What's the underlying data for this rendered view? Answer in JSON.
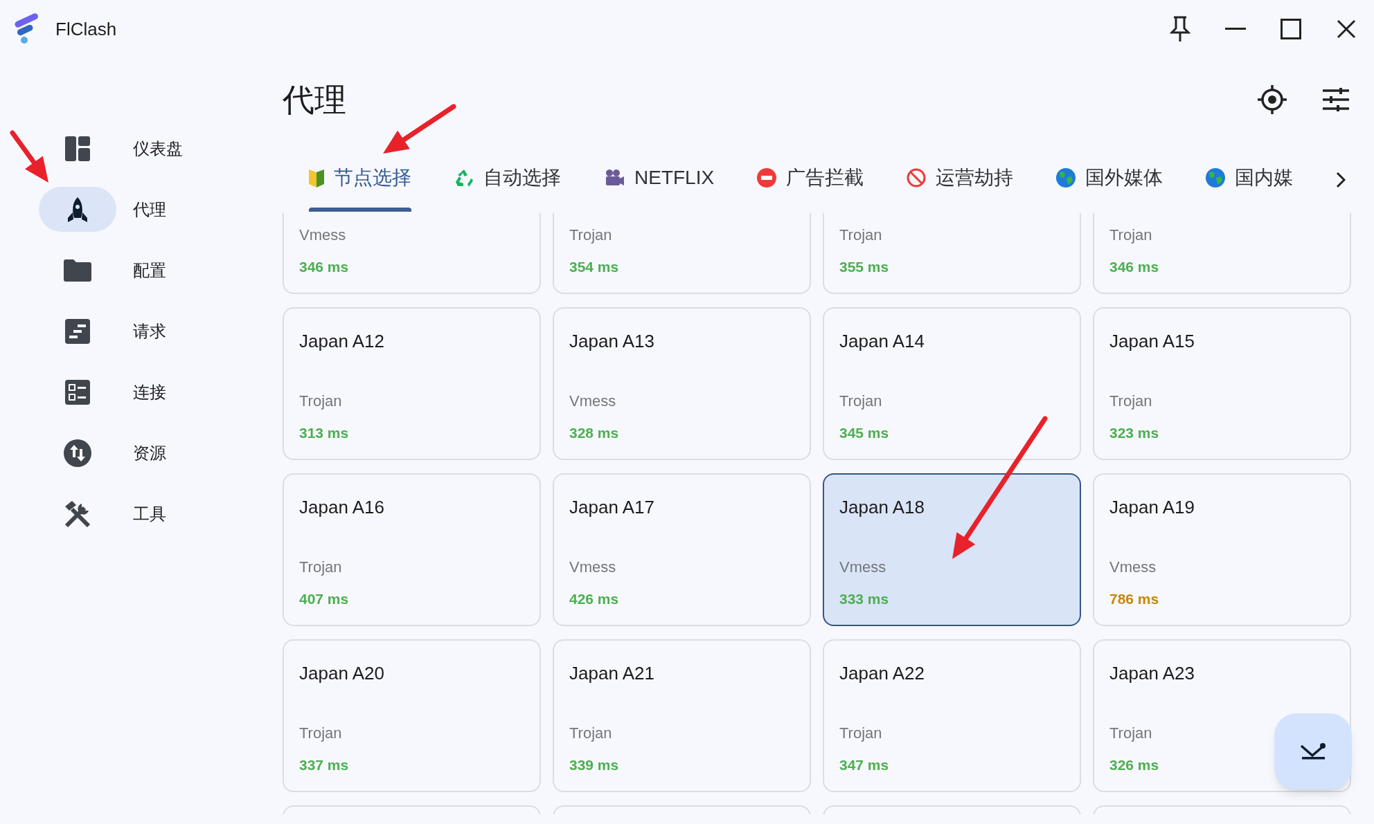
{
  "app": {
    "title": "FlClash"
  },
  "sidebar": {
    "items": [
      {
        "label": "仪表盘",
        "kind": "dashboard",
        "selected": false
      },
      {
        "label": "代理",
        "kind": "rocket",
        "selected": true
      },
      {
        "label": "配置",
        "kind": "folder",
        "selected": false
      },
      {
        "label": "请求",
        "kind": "requests",
        "selected": false
      },
      {
        "label": "连接",
        "kind": "connections",
        "selected": false
      },
      {
        "label": "资源",
        "kind": "resources",
        "selected": false
      },
      {
        "label": "工具",
        "kind": "tools",
        "selected": false
      }
    ]
  },
  "page": {
    "title": "代理"
  },
  "tabs": [
    {
      "label": "节点选择",
      "kind": "badge",
      "selected": true
    },
    {
      "label": "自动选择",
      "kind": "recycle",
      "selected": false
    },
    {
      "label": "NETFLIX",
      "kind": "camera",
      "selected": false
    },
    {
      "label": "广告拦截",
      "kind": "no-entry",
      "selected": false
    },
    {
      "label": "运营劫持",
      "kind": "prohibited",
      "selected": false
    },
    {
      "label": "国外媒体",
      "kind": "globe",
      "selected": false
    },
    {
      "label": "国内媒",
      "kind": "globe",
      "selected": false
    }
  ],
  "nodes": [
    {
      "type": "Vmess",
      "delay": "346 ms",
      "color": "#4caf50",
      "selected": false
    },
    {
      "type": "Trojan",
      "delay": "354 ms",
      "color": "#4caf50",
      "selected": false
    },
    {
      "type": "Trojan",
      "delay": "355 ms",
      "color": "#4caf50",
      "selected": false
    },
    {
      "type": "Trojan",
      "delay": "346 ms",
      "color": "#4caf50",
      "selected": false
    },
    {
      "name": "Japan A12",
      "type": "Trojan",
      "delay": "313 ms",
      "color": "#4caf50",
      "selected": false
    },
    {
      "name": "Japan A13",
      "type": "Vmess",
      "delay": "328 ms",
      "color": "#4caf50",
      "selected": false
    },
    {
      "name": "Japan A14",
      "type": "Trojan",
      "delay": "345 ms",
      "color": "#4caf50",
      "selected": false
    },
    {
      "name": "Japan A15",
      "type": "Trojan",
      "delay": "323 ms",
      "color": "#4caf50",
      "selected": false
    },
    {
      "name": "Japan A16",
      "type": "Trojan",
      "delay": "407 ms",
      "color": "#4caf50",
      "selected": false
    },
    {
      "name": "Japan A17",
      "type": "Vmess",
      "delay": "426 ms",
      "color": "#4caf50",
      "selected": false
    },
    {
      "name": "Japan A18",
      "type": "Vmess",
      "delay": "333 ms",
      "color": "#4caf50",
      "selected": true
    },
    {
      "name": "Japan A19",
      "type": "Vmess",
      "delay": "786 ms",
      "color": "#c8860a",
      "selected": false
    },
    {
      "name": "Japan A20",
      "type": "Trojan",
      "delay": "337 ms",
      "color": "#4caf50",
      "selected": false
    },
    {
      "name": "Japan A21",
      "type": "Trojan",
      "delay": "339 ms",
      "color": "#4caf50",
      "selected": false
    },
    {
      "name": "Japan A22",
      "type": "Trojan",
      "delay": "347 ms",
      "color": "#4caf50",
      "selected": false
    },
    {
      "name": "Japan A23",
      "type": "Trojan",
      "delay": "326 ms",
      "color": "#4caf50",
      "selected": false
    },
    {
      "selected": false
    },
    {
      "selected": false
    },
    {
      "selected": false
    },
    {
      "selected": false
    }
  ]
}
